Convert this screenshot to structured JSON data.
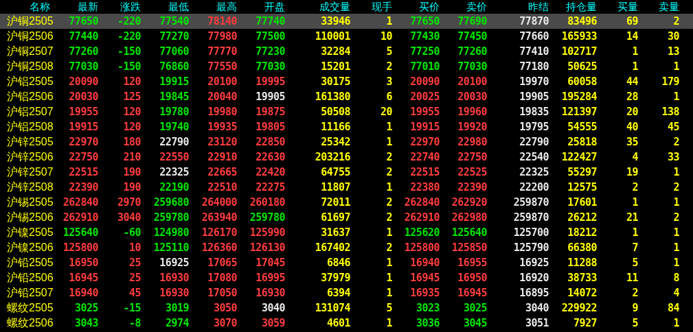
{
  "columns": [
    {
      "label": "名称",
      "kind": "name"
    },
    {
      "label": "最新",
      "kind": "quote"
    },
    {
      "label": "涨跌",
      "kind": "quote"
    },
    {
      "label": "最低",
      "kind": "quote"
    },
    {
      "label": "最高",
      "kind": "quote"
    },
    {
      "label": "开盘",
      "kind": "quote"
    },
    {
      "label": "成交量",
      "kind": "volume"
    },
    {
      "label": "现手",
      "kind": "volume"
    },
    {
      "label": "买价",
      "kind": "quote"
    },
    {
      "label": "卖价",
      "kind": "quote"
    },
    {
      "label": "昨结",
      "kind": "quote"
    },
    {
      "label": "持仓量",
      "kind": "volume"
    },
    {
      "label": "买量",
      "kind": "volume"
    },
    {
      "label": "卖量",
      "kind": "volume"
    }
  ],
  "rows": [
    {
      "name": "沪铜2505",
      "selected": true,
      "cells": [
        {
          "text": "77650",
          "color": "#00e600"
        },
        {
          "text": "-220",
          "color": "#00e600"
        },
        {
          "text": "77540",
          "color": "#00e600"
        },
        {
          "text": "78140",
          "color": "#ff3c3c"
        },
        {
          "text": "77740",
          "color": "#00e600"
        },
        {
          "text": "33946"
        },
        {
          "text": "1"
        },
        {
          "text": "77650",
          "color": "#00e600"
        },
        {
          "text": "77690",
          "color": "#00e600"
        },
        {
          "text": "77870",
          "color": "#e8e8e8"
        },
        {
          "text": "83496"
        },
        {
          "text": "69"
        },
        {
          "text": "2"
        }
      ]
    },
    {
      "name": "沪铜2506",
      "selected": false,
      "cells": [
        {
          "text": "77440",
          "color": "#00e600"
        },
        {
          "text": "-220",
          "color": "#00e600"
        },
        {
          "text": "77270",
          "color": "#00e600"
        },
        {
          "text": "77980",
          "color": "#ff3c3c"
        },
        {
          "text": "77500",
          "color": "#00e600"
        },
        {
          "text": "110001"
        },
        {
          "text": "10"
        },
        {
          "text": "77430",
          "color": "#00e600"
        },
        {
          "text": "77450",
          "color": "#00e600"
        },
        {
          "text": "77660",
          "color": "#e8e8e8"
        },
        {
          "text": "165933"
        },
        {
          "text": "14"
        },
        {
          "text": "30"
        }
      ]
    },
    {
      "name": "沪铜2507",
      "selected": false,
      "cells": [
        {
          "text": "77260",
          "color": "#00e600"
        },
        {
          "text": "-150",
          "color": "#00e600"
        },
        {
          "text": "77060",
          "color": "#00e600"
        },
        {
          "text": "77770",
          "color": "#ff3c3c"
        },
        {
          "text": "77230",
          "color": "#00e600"
        },
        {
          "text": "32284"
        },
        {
          "text": "5"
        },
        {
          "text": "77250",
          "color": "#00e600"
        },
        {
          "text": "77260",
          "color": "#00e600"
        },
        {
          "text": "77410",
          "color": "#e8e8e8"
        },
        {
          "text": "102717"
        },
        {
          "text": "1"
        },
        {
          "text": "13"
        }
      ]
    },
    {
      "name": "沪铜2508",
      "selected": false,
      "cells": [
        {
          "text": "77030",
          "color": "#00e600"
        },
        {
          "text": "-150",
          "color": "#00e600"
        },
        {
          "text": "76860",
          "color": "#00e600"
        },
        {
          "text": "77550",
          "color": "#ff3c3c"
        },
        {
          "text": "77030",
          "color": "#00e600"
        },
        {
          "text": "15201"
        },
        {
          "text": "2"
        },
        {
          "text": "77010",
          "color": "#00e600"
        },
        {
          "text": "77030",
          "color": "#00e600"
        },
        {
          "text": "77180",
          "color": "#e8e8e8"
        },
        {
          "text": "50625"
        },
        {
          "text": "1"
        },
        {
          "text": "1"
        }
      ]
    },
    {
      "name": "沪铝2505",
      "selected": false,
      "cells": [
        {
          "text": "20090",
          "color": "#ff3c3c"
        },
        {
          "text": "120",
          "color": "#ff3c3c"
        },
        {
          "text": "19915",
          "color": "#00e600"
        },
        {
          "text": "20100",
          "color": "#ff3c3c"
        },
        {
          "text": "19995",
          "color": "#ff3c3c"
        },
        {
          "text": "30175"
        },
        {
          "text": "3"
        },
        {
          "text": "20090",
          "color": "#ff3c3c"
        },
        {
          "text": "20100",
          "color": "#ff3c3c"
        },
        {
          "text": "19970",
          "color": "#e8e8e8"
        },
        {
          "text": "60058"
        },
        {
          "text": "44"
        },
        {
          "text": "179"
        }
      ]
    },
    {
      "name": "沪铝2506",
      "selected": false,
      "cells": [
        {
          "text": "20030",
          "color": "#ff3c3c"
        },
        {
          "text": "125",
          "color": "#ff3c3c"
        },
        {
          "text": "19845",
          "color": "#00e600"
        },
        {
          "text": "20040",
          "color": "#ff3c3c"
        },
        {
          "text": "19905",
          "color": "#e8e8e8"
        },
        {
          "text": "161380"
        },
        {
          "text": "6"
        },
        {
          "text": "20025",
          "color": "#ff3c3c"
        },
        {
          "text": "20030",
          "color": "#ff3c3c"
        },
        {
          "text": "19905",
          "color": "#e8e8e8"
        },
        {
          "text": "195284"
        },
        {
          "text": "28"
        },
        {
          "text": "1"
        }
      ]
    },
    {
      "name": "沪铝2507",
      "selected": false,
      "cells": [
        {
          "text": "19955",
          "color": "#ff3c3c"
        },
        {
          "text": "120",
          "color": "#ff3c3c"
        },
        {
          "text": "19780",
          "color": "#00e600"
        },
        {
          "text": "19980",
          "color": "#ff3c3c"
        },
        {
          "text": "19875",
          "color": "#ff3c3c"
        },
        {
          "text": "50508"
        },
        {
          "text": "20"
        },
        {
          "text": "19955",
          "color": "#ff3c3c"
        },
        {
          "text": "19960",
          "color": "#ff3c3c"
        },
        {
          "text": "19835",
          "color": "#e8e8e8"
        },
        {
          "text": "121397"
        },
        {
          "text": "20"
        },
        {
          "text": "138"
        }
      ]
    },
    {
      "name": "沪铝2508",
      "selected": false,
      "cells": [
        {
          "text": "19915",
          "color": "#ff3c3c"
        },
        {
          "text": "120",
          "color": "#ff3c3c"
        },
        {
          "text": "19740",
          "color": "#00e600"
        },
        {
          "text": "19935",
          "color": "#ff3c3c"
        },
        {
          "text": "19805",
          "color": "#ff3c3c"
        },
        {
          "text": "11166"
        },
        {
          "text": "1"
        },
        {
          "text": "19915",
          "color": "#ff3c3c"
        },
        {
          "text": "19920",
          "color": "#ff3c3c"
        },
        {
          "text": "19795",
          "color": "#e8e8e8"
        },
        {
          "text": "54555"
        },
        {
          "text": "40"
        },
        {
          "text": "45"
        }
      ]
    },
    {
      "name": "沪锌2505",
      "selected": false,
      "cells": [
        {
          "text": "22970",
          "color": "#ff3c3c"
        },
        {
          "text": "180",
          "color": "#ff3c3c"
        },
        {
          "text": "22790",
          "color": "#e8e8e8"
        },
        {
          "text": "23120",
          "color": "#ff3c3c"
        },
        {
          "text": "22850",
          "color": "#ff3c3c"
        },
        {
          "text": "25342"
        },
        {
          "text": "1"
        },
        {
          "text": "22970",
          "color": "#ff3c3c"
        },
        {
          "text": "22980",
          "color": "#ff3c3c"
        },
        {
          "text": "22790",
          "color": "#e8e8e8"
        },
        {
          "text": "25818"
        },
        {
          "text": "35"
        },
        {
          "text": "2"
        }
      ]
    },
    {
      "name": "沪锌2506",
      "selected": false,
      "cells": [
        {
          "text": "22750",
          "color": "#ff3c3c"
        },
        {
          "text": "210",
          "color": "#ff3c3c"
        },
        {
          "text": "22550",
          "color": "#ff3c3c"
        },
        {
          "text": "22910",
          "color": "#ff3c3c"
        },
        {
          "text": "22630",
          "color": "#ff3c3c"
        },
        {
          "text": "203216"
        },
        {
          "text": "2"
        },
        {
          "text": "22740",
          "color": "#ff3c3c"
        },
        {
          "text": "22750",
          "color": "#ff3c3c"
        },
        {
          "text": "22540",
          "color": "#e8e8e8"
        },
        {
          "text": "122427"
        },
        {
          "text": "4"
        },
        {
          "text": "33"
        }
      ]
    },
    {
      "name": "沪锌2507",
      "selected": false,
      "cells": [
        {
          "text": "22515",
          "color": "#ff3c3c"
        },
        {
          "text": "190",
          "color": "#ff3c3c"
        },
        {
          "text": "22325",
          "color": "#e8e8e8"
        },
        {
          "text": "22665",
          "color": "#ff3c3c"
        },
        {
          "text": "22420",
          "color": "#ff3c3c"
        },
        {
          "text": "64755"
        },
        {
          "text": "2"
        },
        {
          "text": "22515",
          "color": "#ff3c3c"
        },
        {
          "text": "22525",
          "color": "#ff3c3c"
        },
        {
          "text": "22325",
          "color": "#e8e8e8"
        },
        {
          "text": "55297"
        },
        {
          "text": "19"
        },
        {
          "text": "1"
        }
      ]
    },
    {
      "name": "沪锌2508",
      "selected": false,
      "cells": [
        {
          "text": "22390",
          "color": "#ff3c3c"
        },
        {
          "text": "190",
          "color": "#ff3c3c"
        },
        {
          "text": "22190",
          "color": "#00e600"
        },
        {
          "text": "22510",
          "color": "#ff3c3c"
        },
        {
          "text": "22275",
          "color": "#ff3c3c"
        },
        {
          "text": "11807"
        },
        {
          "text": "1"
        },
        {
          "text": "22380",
          "color": "#ff3c3c"
        },
        {
          "text": "22390",
          "color": "#ff3c3c"
        },
        {
          "text": "22200",
          "color": "#e8e8e8"
        },
        {
          "text": "12575"
        },
        {
          "text": "2"
        },
        {
          "text": "2"
        }
      ]
    },
    {
      "name": "沪锡2505",
      "selected": false,
      "cells": [
        {
          "text": "262840",
          "color": "#ff3c3c"
        },
        {
          "text": "2970",
          "color": "#ff3c3c"
        },
        {
          "text": "259680",
          "color": "#00e600"
        },
        {
          "text": "264000",
          "color": "#ff3c3c"
        },
        {
          "text": "260180",
          "color": "#ff3c3c"
        },
        {
          "text": "72011"
        },
        {
          "text": "2"
        },
        {
          "text": "262840",
          "color": "#ff3c3c"
        },
        {
          "text": "262920",
          "color": "#ff3c3c"
        },
        {
          "text": "259870",
          "color": "#e8e8e8"
        },
        {
          "text": "17601"
        },
        {
          "text": "1"
        },
        {
          "text": "1"
        }
      ]
    },
    {
      "name": "沪锡2506",
      "selected": false,
      "cells": [
        {
          "text": "262910",
          "color": "#ff3c3c"
        },
        {
          "text": "3040",
          "color": "#ff3c3c"
        },
        {
          "text": "259780",
          "color": "#00e600"
        },
        {
          "text": "263940",
          "color": "#ff3c3c"
        },
        {
          "text": "259780",
          "color": "#00e600"
        },
        {
          "text": "61697"
        },
        {
          "text": "2"
        },
        {
          "text": "262910",
          "color": "#ff3c3c"
        },
        {
          "text": "262980",
          "color": "#ff3c3c"
        },
        {
          "text": "259870",
          "color": "#e8e8e8"
        },
        {
          "text": "26212"
        },
        {
          "text": "21"
        },
        {
          "text": "2"
        }
      ]
    },
    {
      "name": "沪镍2505",
      "selected": false,
      "cells": [
        {
          "text": "125640",
          "color": "#00e600"
        },
        {
          "text": "-60",
          "color": "#00e600"
        },
        {
          "text": "124980",
          "color": "#00e600"
        },
        {
          "text": "126170",
          "color": "#ff3c3c"
        },
        {
          "text": "125990",
          "color": "#ff3c3c"
        },
        {
          "text": "31637"
        },
        {
          "text": "1"
        },
        {
          "text": "125620",
          "color": "#00e600"
        },
        {
          "text": "125640",
          "color": "#00e600"
        },
        {
          "text": "125700",
          "color": "#e8e8e8"
        },
        {
          "text": "18212"
        },
        {
          "text": "1"
        },
        {
          "text": "1"
        }
      ]
    },
    {
      "name": "沪镍2506",
      "selected": false,
      "cells": [
        {
          "text": "125800",
          "color": "#ff3c3c"
        },
        {
          "text": "10",
          "color": "#ff3c3c"
        },
        {
          "text": "125110",
          "color": "#00e600"
        },
        {
          "text": "126360",
          "color": "#ff3c3c"
        },
        {
          "text": "126130",
          "color": "#ff3c3c"
        },
        {
          "text": "167402"
        },
        {
          "text": "2"
        },
        {
          "text": "125800",
          "color": "#ff3c3c"
        },
        {
          "text": "125850",
          "color": "#ff3c3c"
        },
        {
          "text": "125790",
          "color": "#e8e8e8"
        },
        {
          "text": "66380"
        },
        {
          "text": "7"
        },
        {
          "text": "1"
        }
      ]
    },
    {
      "name": "沪铅2505",
      "selected": false,
      "cells": [
        {
          "text": "16950",
          "color": "#ff3c3c"
        },
        {
          "text": "25",
          "color": "#ff3c3c"
        },
        {
          "text": "16925",
          "color": "#e8e8e8"
        },
        {
          "text": "17065",
          "color": "#ff3c3c"
        },
        {
          "text": "17045",
          "color": "#ff3c3c"
        },
        {
          "text": "6846"
        },
        {
          "text": "1"
        },
        {
          "text": "16940",
          "color": "#ff3c3c"
        },
        {
          "text": "16955",
          "color": "#ff3c3c"
        },
        {
          "text": "16925",
          "color": "#e8e8e8"
        },
        {
          "text": "11288"
        },
        {
          "text": "5"
        },
        {
          "text": "1"
        }
      ]
    },
    {
      "name": "沪铅2506",
      "selected": false,
      "cells": [
        {
          "text": "16945",
          "color": "#ff3c3c"
        },
        {
          "text": "25",
          "color": "#ff3c3c"
        },
        {
          "text": "16930",
          "color": "#ff3c3c"
        },
        {
          "text": "17080",
          "color": "#ff3c3c"
        },
        {
          "text": "16995",
          "color": "#ff3c3c"
        },
        {
          "text": "37979"
        },
        {
          "text": "1"
        },
        {
          "text": "16945",
          "color": "#ff3c3c"
        },
        {
          "text": "16950",
          "color": "#ff3c3c"
        },
        {
          "text": "16920",
          "color": "#e8e8e8"
        },
        {
          "text": "38733"
        },
        {
          "text": "11"
        },
        {
          "text": "8"
        }
      ]
    },
    {
      "name": "沪铅2507",
      "selected": false,
      "cells": [
        {
          "text": "16940",
          "color": "#ff3c3c"
        },
        {
          "text": "45",
          "color": "#ff3c3c"
        },
        {
          "text": "16930",
          "color": "#ff3c3c"
        },
        {
          "text": "17050",
          "color": "#ff3c3c"
        },
        {
          "text": "16930",
          "color": "#ff3c3c"
        },
        {
          "text": "6394"
        },
        {
          "text": "1"
        },
        {
          "text": "16935",
          "color": "#ff3c3c"
        },
        {
          "text": "16945",
          "color": "#ff3c3c"
        },
        {
          "text": "16895",
          "color": "#e8e8e8"
        },
        {
          "text": "14072"
        },
        {
          "text": "2"
        },
        {
          "text": "4"
        }
      ]
    },
    {
      "name": "螺纹2505",
      "selected": false,
      "cells": [
        {
          "text": "3025",
          "color": "#00e600"
        },
        {
          "text": "-15",
          "color": "#00e600"
        },
        {
          "text": "3019",
          "color": "#00e600"
        },
        {
          "text": "3050",
          "color": "#ff3c3c"
        },
        {
          "text": "3040",
          "color": "#e8e8e8"
        },
        {
          "text": "131074"
        },
        {
          "text": "5"
        },
        {
          "text": "3023",
          "color": "#00e600"
        },
        {
          "text": "3025",
          "color": "#00e600"
        },
        {
          "text": "3040",
          "color": "#e8e8e8"
        },
        {
          "text": "229922"
        },
        {
          "text": "9"
        },
        {
          "text": "84"
        }
      ]
    },
    {
      "name": "螺纹2506",
      "selected": false,
      "cells": [
        {
          "text": "3043",
          "color": "#00e600"
        },
        {
          "text": "-8",
          "color": "#00e600"
        },
        {
          "text": "2974",
          "color": "#00e600"
        },
        {
          "text": "3070",
          "color": "#ff3c3c"
        },
        {
          "text": "3059",
          "color": "#ff3c3c"
        },
        {
          "text": "4601"
        },
        {
          "text": "1"
        },
        {
          "text": "3036",
          "color": "#00e600"
        },
        {
          "text": "3045",
          "color": "#00e600"
        },
        {
          "text": "3051",
          "color": "#e8e8e8"
        },
        {
          "text": "7927"
        },
        {
          "text": "5"
        },
        {
          "text": "1"
        }
      ]
    }
  ]
}
